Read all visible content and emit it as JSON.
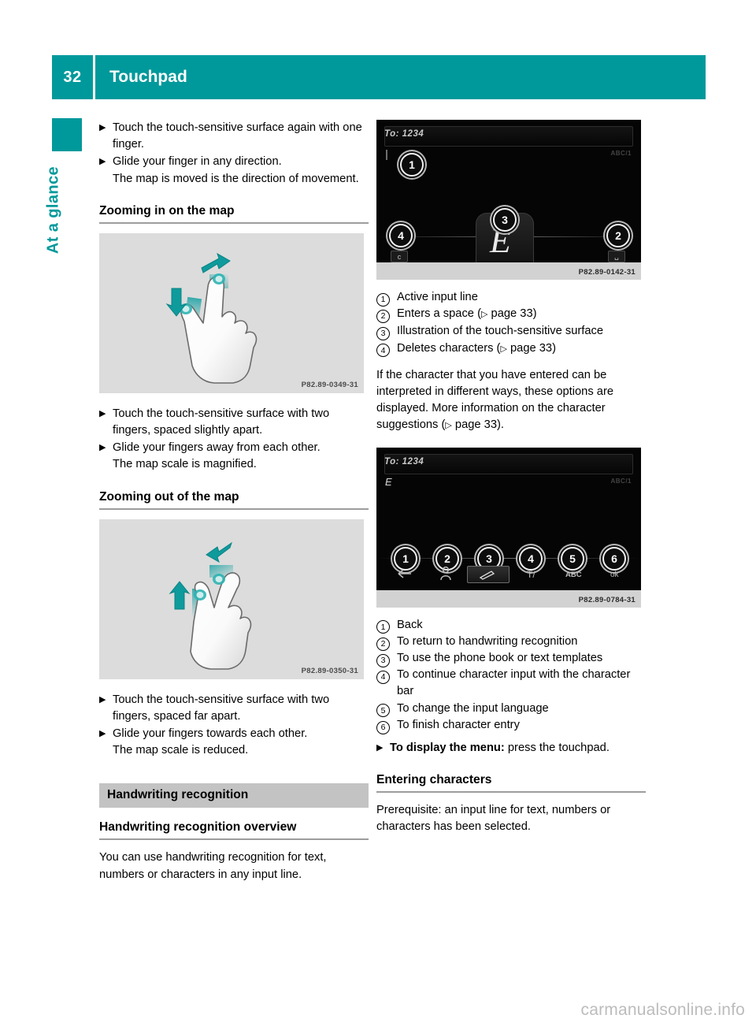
{
  "header": {
    "page_number": "32",
    "title": "Touchpad"
  },
  "sidebar": {
    "chapter_label": "At a glance"
  },
  "left_column": {
    "intro_bullets": [
      {
        "mark": "▶",
        "main": "Touch the touch-sensitive surface again with one finger.",
        "sub": ""
      },
      {
        "mark": "▶",
        "main": "Glide your finger in any direction.",
        "sub": "The map is moved is the direction of movement."
      }
    ],
    "heading_zoom_in": "Zooming in on the map",
    "figure_zoom_in": {
      "caption": "P82.89-0349-31",
      "alt": "hand-pinch-out-gesture"
    },
    "zoom_in_bullets": [
      {
        "mark": "▶",
        "main": "Touch the touch-sensitive surface with two fingers, spaced slightly apart.",
        "sub": ""
      },
      {
        "mark": "▶",
        "main": "Glide your fingers away from each other.",
        "sub": "The map scale is magnified."
      }
    ],
    "heading_zoom_out": "Zooming out of the map",
    "figure_zoom_out": {
      "caption": "P82.89-0350-31",
      "alt": "hand-pinch-in-gesture"
    },
    "zoom_out_bullets": [
      {
        "mark": "▶",
        "main": "Touch the touch-sensitive surface with two fingers, spaced far apart.",
        "sub": ""
      },
      {
        "mark": "▶",
        "main": "Glide your fingers towards each other.",
        "sub": "The map scale is reduced."
      }
    ],
    "section_handwriting": "Handwriting recognition",
    "heading_overview": "Handwriting recognition overview",
    "overview_text": "You can use handwriting recognition for text, numbers or characters in any input line."
  },
  "right_column": {
    "figure_input": {
      "caption": "P82.89-0142-31",
      "screen_to_label": "To: 1234",
      "screen_mode": "ABC/1",
      "screen_glyph": "E",
      "callouts": [
        "1",
        "2",
        "3",
        "4"
      ],
      "key_left": "c",
      "key_right": "␣"
    },
    "legend_input": [
      {
        "num": "1",
        "text": "Active input line",
        "ref": ""
      },
      {
        "num": "2",
        "text": "Enters a space",
        "ref": "page 33"
      },
      {
        "num": "3",
        "text": "Illustration of the touch-sensitive surface",
        "ref": ""
      },
      {
        "num": "4",
        "text": "Deletes characters",
        "ref": "page 33"
      }
    ],
    "paragraph_suggestions": "If the character that you have entered can be interpreted in different ways, these options are displayed. More information on the character suggestions (",
    "paragraph_suggestions_ref": "page 33",
    "paragraph_suggestions_end": ").",
    "figure_menu": {
      "caption": "P82.89-0784-31",
      "screen_to_label": "To: 1234",
      "screen_mode": "ABC/1",
      "screen_entered": "E",
      "callouts": [
        "1",
        "2",
        "3",
        "4",
        "5",
        "6"
      ],
      "icons": [
        "back-arrow",
        "phone-book",
        "pen",
        "T/",
        "ABC",
        "ok"
      ]
    },
    "legend_menu": [
      {
        "num": "1",
        "text": "Back"
      },
      {
        "num": "2",
        "text": "To return to handwriting recognition"
      },
      {
        "num": "3",
        "text": "To use the phone book or text templates"
      },
      {
        "num": "4",
        "text": "To continue character input with the character bar"
      },
      {
        "num": "5",
        "text": "To change the input language"
      },
      {
        "num": "6",
        "text": "To finish character entry"
      }
    ],
    "display_menu_bullet": {
      "mark": "▶",
      "bold": "To display the menu:",
      "rest": " press the touchpad."
    },
    "heading_entering": "Entering characters",
    "entering_text": "Prerequisite: an input line for text, numbers or characters has been selected."
  },
  "footer": {
    "watermark": "carmanualsonline.info"
  },
  "colors": {
    "accent": "#00999b",
    "section_bar": "#c3c3c3",
    "figure_bg": "#dcdcdc",
    "rule": "#9d9d9d"
  }
}
